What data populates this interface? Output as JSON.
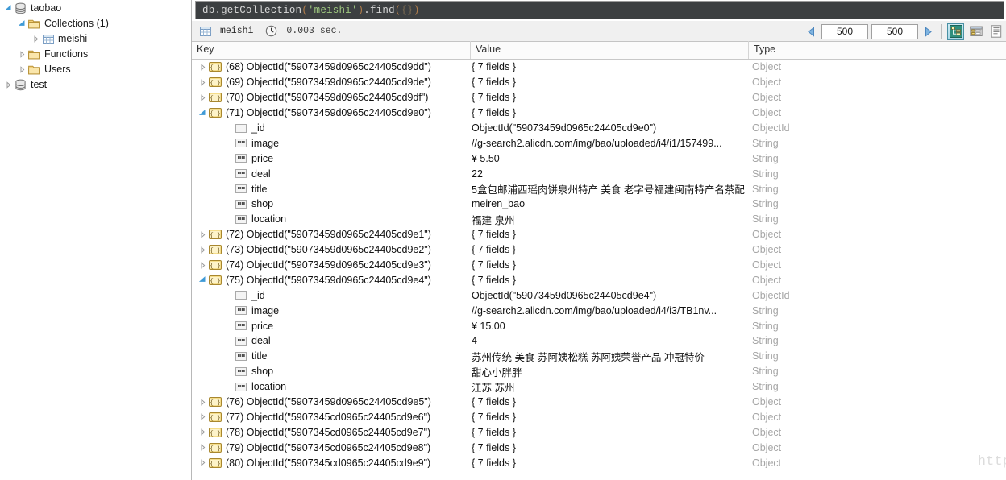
{
  "sidebar": {
    "items": [
      {
        "label": "taobao",
        "depth": 0,
        "icon": "database-icon",
        "expanded": true,
        "twisty": "down"
      },
      {
        "label": "Collections (1)",
        "depth": 1,
        "icon": "folder-icon",
        "expanded": true,
        "twisty": "down"
      },
      {
        "label": "meishi",
        "depth": 2,
        "icon": "table-icon",
        "expanded": false,
        "twisty": "right"
      },
      {
        "label": "Functions",
        "depth": 1,
        "icon": "folder-icon",
        "expanded": false,
        "twisty": "right"
      },
      {
        "label": "Users",
        "depth": 1,
        "icon": "folder-icon",
        "expanded": false,
        "twisty": "right"
      },
      {
        "label": "test",
        "depth": 0,
        "icon": "database-icon",
        "expanded": false,
        "twisty": "right"
      }
    ]
  },
  "query": {
    "tokens": [
      {
        "text": "db.getCollection",
        "kind": "plain"
      },
      {
        "text": "(",
        "kind": "paren"
      },
      {
        "text": "'meishi'",
        "kind": "str"
      },
      {
        "text": ")",
        "kind": "paren"
      },
      {
        "text": ".find",
        "kind": "plain"
      },
      {
        "text": "(",
        "kind": "paren"
      },
      {
        "text": "{}",
        "kind": "brace"
      },
      {
        "text": ")",
        "kind": "paren"
      }
    ],
    "full_text": "db.getCollection('meishi').find({})"
  },
  "status": {
    "collection": "meishi",
    "collection_icon": "table-icon",
    "clock_icon": "clock-icon",
    "time": "0.003 sec."
  },
  "toolbar": {
    "prev_icon": "arrow-left-icon",
    "next_icon": "arrow-right-icon",
    "skip_value": "500",
    "limit_value": "500",
    "views": [
      {
        "name": "tree-view",
        "icon": "tree-view-icon",
        "active": true
      },
      {
        "name": "table-view",
        "icon": "table-view-icon",
        "active": false
      },
      {
        "name": "text-view",
        "icon": "text-view-icon",
        "active": false
      }
    ]
  },
  "grid": {
    "columns": [
      "Key",
      "Value",
      "Type"
    ],
    "rows": [
      {
        "kind": "doc",
        "twisty": "right",
        "icon": "document-icon",
        "key": "(68) ObjectId(\"59073459d0965c24405cd9dd\")",
        "value": "{ 7 fields }",
        "type": "Object"
      },
      {
        "kind": "doc",
        "twisty": "right",
        "icon": "document-icon",
        "key": "(69) ObjectId(\"59073459d0965c24405cd9de\")",
        "value": "{ 7 fields }",
        "type": "Object"
      },
      {
        "kind": "doc",
        "twisty": "right",
        "icon": "document-icon",
        "key": "(70) ObjectId(\"59073459d0965c24405cd9df\")",
        "value": "{ 7 fields }",
        "type": "Object"
      },
      {
        "kind": "doc",
        "twisty": "down",
        "icon": "document-icon",
        "key": "(71) ObjectId(\"59073459d0965c24405cd9e0\")",
        "value": "{ 7 fields }",
        "type": "Object"
      },
      {
        "kind": "field",
        "twisty": "none",
        "icon": "objectid-icon",
        "key": "_id",
        "value": "ObjectId(\"59073459d0965c24405cd9e0\")",
        "type": "ObjectId"
      },
      {
        "kind": "field",
        "twisty": "none",
        "icon": "string-icon",
        "key": "image",
        "value": "//g-search2.alicdn.com/img/bao/uploaded/i4/i1/157499...",
        "type": "String"
      },
      {
        "kind": "field",
        "twisty": "none",
        "icon": "string-icon",
        "key": "price",
        "value": "¥ 5.50",
        "type": "String"
      },
      {
        "kind": "field",
        "twisty": "none",
        "icon": "string-icon",
        "key": "deal",
        "value": "22",
        "type": "String"
      },
      {
        "kind": "field",
        "twisty": "none",
        "icon": "string-icon",
        "key": "title",
        "value": "5盒包邮浦西瑶肉饼泉州特产 美食 老字号福建闽南特产名茶配",
        "type": "String"
      },
      {
        "kind": "field",
        "twisty": "none",
        "icon": "string-icon",
        "key": "shop",
        "value": "meiren_bao",
        "type": "String"
      },
      {
        "kind": "field",
        "twisty": "none",
        "icon": "string-icon",
        "key": "location",
        "value": "福建 泉州",
        "type": "String"
      },
      {
        "kind": "doc",
        "twisty": "right",
        "icon": "document-icon",
        "key": "(72) ObjectId(\"59073459d0965c24405cd9e1\")",
        "value": "{ 7 fields }",
        "type": "Object"
      },
      {
        "kind": "doc",
        "twisty": "right",
        "icon": "document-icon",
        "key": "(73) ObjectId(\"59073459d0965c24405cd9e2\")",
        "value": "{ 7 fields }",
        "type": "Object"
      },
      {
        "kind": "doc",
        "twisty": "right",
        "icon": "document-icon",
        "key": "(74) ObjectId(\"59073459d0965c24405cd9e3\")",
        "value": "{ 7 fields }",
        "type": "Object"
      },
      {
        "kind": "doc",
        "twisty": "down",
        "icon": "document-icon",
        "key": "(75) ObjectId(\"59073459d0965c24405cd9e4\")",
        "value": "{ 7 fields }",
        "type": "Object"
      },
      {
        "kind": "field",
        "twisty": "none",
        "icon": "objectid-icon",
        "key": "_id",
        "value": "ObjectId(\"59073459d0965c24405cd9e4\")",
        "type": "ObjectId"
      },
      {
        "kind": "field",
        "twisty": "none",
        "icon": "string-icon",
        "key": "image",
        "value": "//g-search2.alicdn.com/img/bao/uploaded/i4/i3/TB1nv...",
        "type": "String"
      },
      {
        "kind": "field",
        "twisty": "none",
        "icon": "string-icon",
        "key": "price",
        "value": "¥ 15.00",
        "type": "String"
      },
      {
        "kind": "field",
        "twisty": "none",
        "icon": "string-icon",
        "key": "deal",
        "value": "4",
        "type": "String"
      },
      {
        "kind": "field",
        "twisty": "none",
        "icon": "string-icon",
        "key": "title",
        "value": "苏州传统 美食 苏阿姨松糕 苏阿姨荣誉产品 冲冠特价",
        "type": "String"
      },
      {
        "kind": "field",
        "twisty": "none",
        "icon": "string-icon",
        "key": "shop",
        "value": "甜心小胖胖",
        "type": "String"
      },
      {
        "kind": "field",
        "twisty": "none",
        "icon": "string-icon",
        "key": "location",
        "value": "江苏 苏州",
        "type": "String"
      },
      {
        "kind": "doc",
        "twisty": "right",
        "icon": "document-icon",
        "key": "(76) ObjectId(\"59073459d0965c24405cd9e5\")",
        "value": "{ 7 fields }",
        "type": "Object"
      },
      {
        "kind": "doc",
        "twisty": "right",
        "icon": "document-icon",
        "key": "(77) ObjectId(\"5907345cd0965c24405cd9e6\")",
        "value": "{ 7 fields }",
        "type": "Object"
      },
      {
        "kind": "doc",
        "twisty": "right",
        "icon": "document-icon",
        "key": "(78) ObjectId(\"5907345cd0965c24405cd9e7\")",
        "value": "{ 7 fields }",
        "type": "Object"
      },
      {
        "kind": "doc",
        "twisty": "right",
        "icon": "document-icon",
        "key": "(79) ObjectId(\"5907345cd0965c24405cd9e8\")",
        "value": "{ 7 fields }",
        "type": "Object"
      },
      {
        "kind": "doc",
        "twisty": "right",
        "icon": "document-icon",
        "key": "(80) ObjectId(\"5907345cd0965c24405cd9e9\")",
        "value": "{ 7 fields }",
        "type": "Object"
      }
    ]
  },
  "watermark": {
    "text": "http://blog.csdn.net/Qaz_wz"
  },
  "colors": {
    "editor_bg": "#3c3f41",
    "string_token": "#9ec77f",
    "type_text": "#a6a6a6",
    "active_view": "#a9d8e6"
  }
}
